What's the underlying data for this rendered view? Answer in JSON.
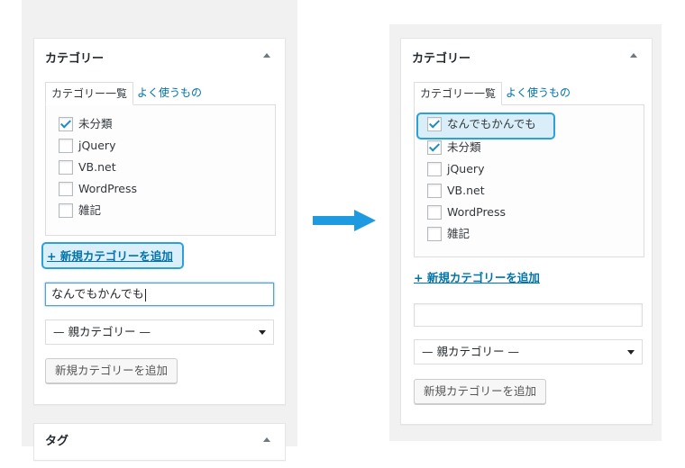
{
  "left": {
    "box_title": "カテゴリー",
    "tabs": [
      "カテゴリー一覧",
      "よく使うもの"
    ],
    "categories": [
      {
        "label": "未分類",
        "checked": true
      },
      {
        "label": "jQuery",
        "checked": false
      },
      {
        "label": "VB.net",
        "checked": false
      },
      {
        "label": "WordPress",
        "checked": false
      },
      {
        "label": "雑記",
        "checked": false
      }
    ],
    "add_link": "+ 新規カテゴリーを追加",
    "new_category_value": "なんでもかんでも",
    "parent_select": "— 親カテゴリー —",
    "add_button": "新規カテゴリーを追加",
    "next_box_title": "タグ"
  },
  "right": {
    "box_title": "カテゴリー",
    "tabs": [
      "カテゴリー一覧",
      "よく使うもの"
    ],
    "categories": [
      {
        "label": "なんでもかんでも",
        "checked": true
      },
      {
        "label": "未分類",
        "checked": true
      },
      {
        "label": "jQuery",
        "checked": false
      },
      {
        "label": "VB.net",
        "checked": false
      },
      {
        "label": "WordPress",
        "checked": false
      },
      {
        "label": "雑記",
        "checked": false
      }
    ],
    "add_link": "+ 新規カテゴリーを追加",
    "new_category_value": "",
    "parent_select": "— 親カテゴリー —",
    "add_button": "新規カテゴリーを追加"
  },
  "colors": {
    "accent": "#0073aa",
    "highlight_border": "#2aa1db",
    "transition_arrow": "#1e9be0"
  },
  "icons": {
    "toggle": "triangle-up-icon",
    "dropdown": "triangle-down-icon",
    "transition": "arrow-right-icon",
    "checkbox": "checkbox-icon"
  }
}
